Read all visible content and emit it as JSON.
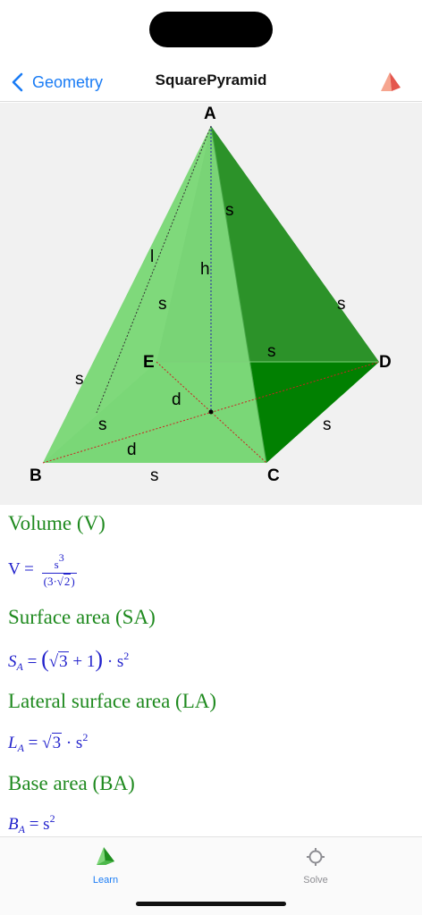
{
  "nav": {
    "back_label": "Geometry",
    "title": "SquarePyramid",
    "icon": "pyramid-icon"
  },
  "figure": {
    "vertices": {
      "a": "A",
      "b": "B",
      "c": "C",
      "d": "D",
      "e": "E"
    },
    "labels": {
      "s": "s",
      "h": "h",
      "l": "l",
      "d": "d"
    },
    "colors": {
      "left_face": "#a3e49c",
      "front_face": "#7cd878",
      "back_face": "#5fa85a",
      "right_face": "#018001",
      "base": "#6ccc69"
    }
  },
  "formulas": {
    "volume": {
      "heading": "Volume (V)",
      "lhs": "V",
      "eq": "=",
      "num_base": "s",
      "num_exp": "3",
      "den": "(3·√2)",
      "den_pre": "(3·",
      "den_rad": "2",
      "den_post": ")"
    },
    "surface": {
      "heading": "Surface area (SA)",
      "lhs": "S",
      "sub": "A",
      "eq": "=",
      "rad": "3",
      "plus": "+ 1",
      "tail": "· s",
      "exp": "2"
    },
    "lateral": {
      "heading": "Lateral surface area (LA)",
      "lhs": "L",
      "sub": "A",
      "eq": "=",
      "rad": "3",
      "tail": "· s",
      "exp": "2"
    },
    "base": {
      "heading": "Base area (BA)",
      "lhs": "B",
      "sub": "A",
      "eq": "=",
      "tail": "s",
      "exp": "2"
    }
  },
  "tabs": {
    "learn": {
      "label": "Learn",
      "icon": "pyramid-icon",
      "active": true
    },
    "solve": {
      "label": "Solve",
      "icon": "crosshair-icon",
      "active": false
    }
  },
  "colors": {
    "accent": "#1a7cf5",
    "heading": "#1f8a1f",
    "formula": "#2222cc",
    "inactive": "#8e8e93"
  }
}
